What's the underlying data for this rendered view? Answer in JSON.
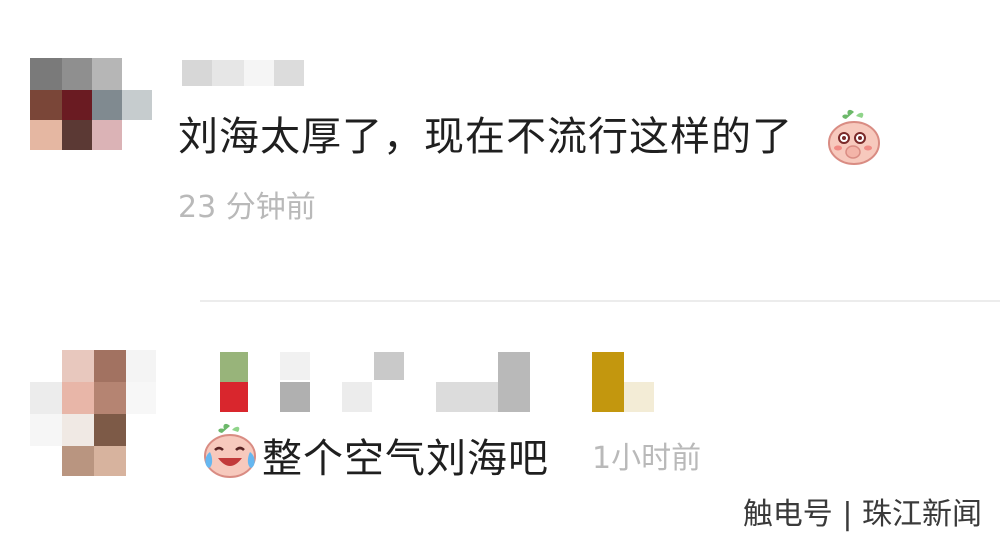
{
  "comments": [
    {
      "avatar_icon": "pixelated-avatar",
      "username_icon": "pixelated-username",
      "text": "刘海太厚了，现在不流行这样的了",
      "emoji_icon": "shy-peach-emoji",
      "time": "23 分钟前"
    },
    {
      "avatar_icon": "pixelated-avatar",
      "username_icon": "pixelated-username",
      "emoji_icon": "laughing-crying-peach-emoji",
      "text": "整个空气刘海吧",
      "time": "1小时前"
    }
  ],
  "watermark": "触电号 | 珠江新闻",
  "colors": {
    "divider": "#ececec",
    "time": "#b9b9b9",
    "text": "#1f1f1f",
    "emoji_peach": "#f7c9bd"
  }
}
